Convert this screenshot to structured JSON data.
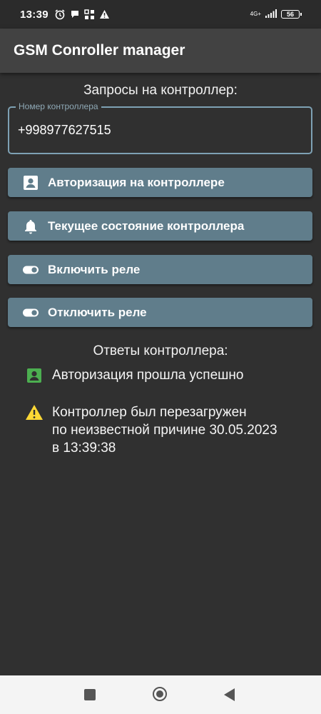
{
  "status_bar": {
    "time": "13:39",
    "network": "4G+",
    "battery": "56",
    "icons": [
      "alarm-icon",
      "chat-bubble-icon",
      "app-grid-icon",
      "warning-icon",
      "signal-icon",
      "battery-icon"
    ]
  },
  "app_bar": {
    "title": "GSM Conroller manager"
  },
  "requests": {
    "heading": "Запросы на контроллер:",
    "phone_field": {
      "label": "Номер контроллера",
      "value": "+998977627515"
    },
    "buttons": [
      {
        "label": "Авторизация на контроллере",
        "icon": "account-box-icon"
      },
      {
        "label": "Текущее состояние контроллера",
        "icon": "bell-icon"
      },
      {
        "label": "Включить реле",
        "icon": "toggle-icon"
      },
      {
        "label": "Отключить реле",
        "icon": "toggle-icon"
      }
    ]
  },
  "responses": {
    "heading": "Ответы контроллера:",
    "items": [
      {
        "text": "Авторизация прошла успешно",
        "icon": "account-box-icon",
        "color": "#4caf50"
      },
      {
        "text": "Контроллер был перезагружен\nпо неизвестной причине 30.05.2023\nв 13:39:38",
        "icon": "warning-icon",
        "color": "#fdd835"
      }
    ]
  },
  "colors": {
    "background": "#303030",
    "app_bar": "#424242",
    "button": "#607d8b",
    "field_border": "#7ea1b4"
  }
}
